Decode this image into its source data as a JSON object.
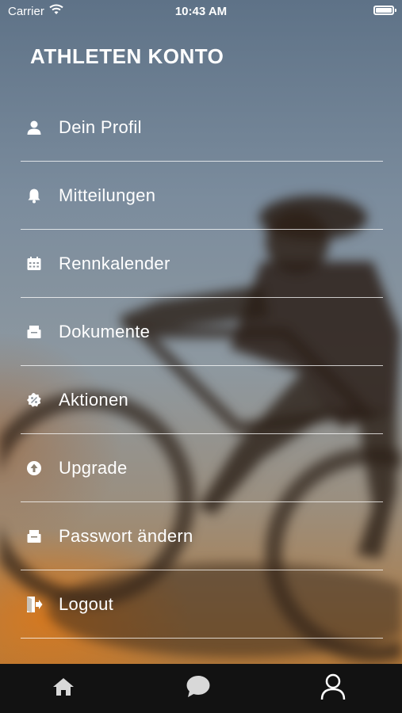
{
  "status_bar": {
    "carrier": "Carrier",
    "time": "10:43 AM"
  },
  "header": {
    "title": "ATHLETEN KONTO"
  },
  "menu": {
    "items": [
      {
        "label": "Dein Profil",
        "icon": "person-icon"
      },
      {
        "label": "Mitteilungen",
        "icon": "bell-icon"
      },
      {
        "label": "Rennkalender",
        "icon": "calendar-icon"
      },
      {
        "label": "Dokumente",
        "icon": "documents-icon"
      },
      {
        "label": "Aktionen",
        "icon": "badge-icon"
      },
      {
        "label": "Upgrade",
        "icon": "upgrade-icon"
      },
      {
        "label": "Passwort ändern",
        "icon": "documents-icon"
      },
      {
        "label": "Logout",
        "icon": "logout-icon"
      }
    ]
  },
  "tabbar": {
    "tabs": [
      {
        "icon": "home-icon"
      },
      {
        "icon": "chat-icon"
      },
      {
        "icon": "profile-icon"
      }
    ]
  }
}
